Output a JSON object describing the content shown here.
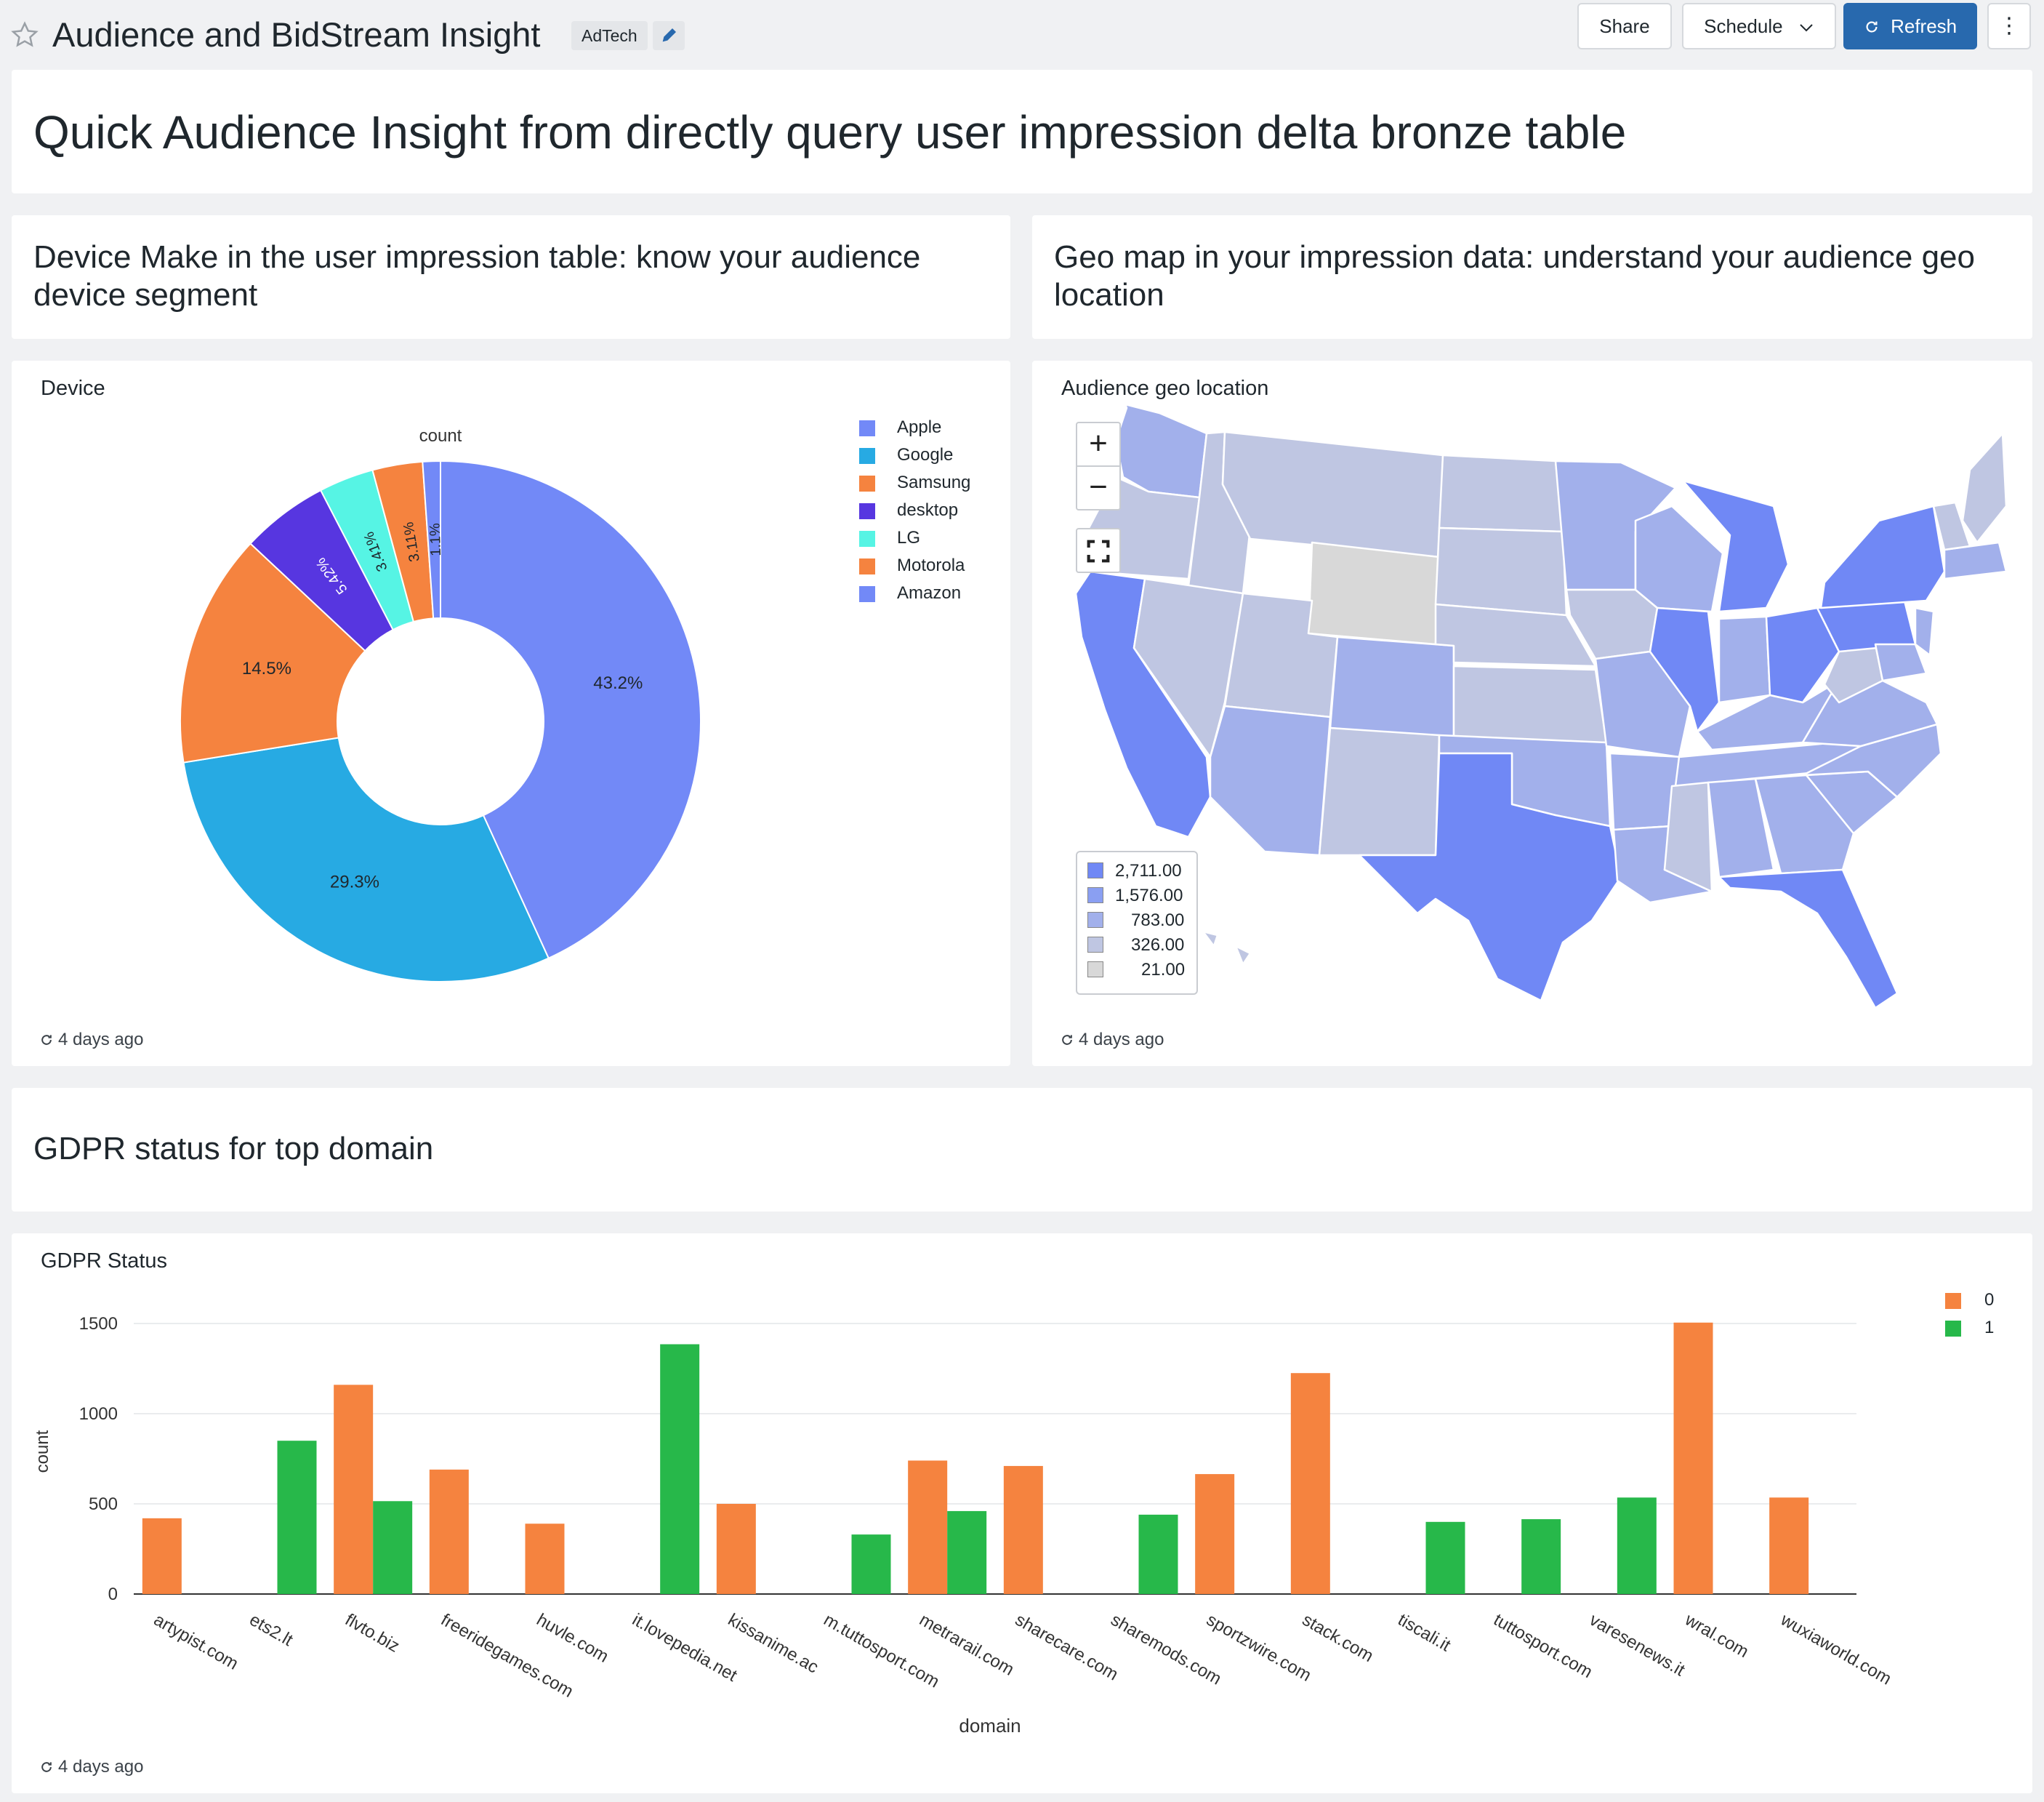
{
  "header": {
    "title": "Audience and BidStream Insight",
    "tag": "AdTech",
    "share_label": "Share",
    "schedule_label": "Schedule",
    "refresh_label": "Refresh",
    "more_label": "⋮"
  },
  "text_widgets": {
    "main_heading": "Quick Audience Insight from directly query user impression delta bronze table",
    "device_heading": "Device Make in the user impression table: know your audience device segment",
    "geo_heading": "Geo map in your impression data: understand your audience geo location",
    "gdpr_heading": "GDPR status for top domain"
  },
  "device_viz": {
    "title": "Device",
    "updated": "4 days ago"
  },
  "geo_viz": {
    "title": "Audience geo location",
    "updated": "4 days ago",
    "zoom_in": "+",
    "zoom_out": "−",
    "legend": [
      {
        "label": "2,711.00",
        "color": "#7088f5"
      },
      {
        "label": "1,576.00",
        "color": "#8a9ff2"
      },
      {
        "label": "783.00",
        "color": "#a2b0eb"
      },
      {
        "label": "326.00",
        "color": "#bfc6e2"
      },
      {
        "label": "21.00",
        "color": "#d8d8d8"
      }
    ]
  },
  "gdpr_viz": {
    "title": "GDPR Status",
    "updated": "4 days ago"
  },
  "chart_data": [
    {
      "type": "pie",
      "title": "count",
      "donut": true,
      "labels": [
        "Apple",
        "Google",
        "Samsung",
        "desktop",
        "LG",
        "Motorola",
        "Amazon"
      ],
      "values": [
        43.2,
        29.3,
        14.5,
        5.42,
        3.41,
        3.11,
        1.1
      ],
      "value_labels": [
        "43.2%",
        "29.3%",
        "14.5%",
        "5.42%",
        "3.41%",
        "3.11%",
        "1.1%"
      ],
      "colors": [
        "#7289f7",
        "#27aae3",
        "#f5833f",
        "#5736e0",
        "#56f4e4",
        "#f5833f",
        "#7289f7"
      ],
      "legend": "top-right"
    },
    {
      "type": "bar",
      "title": "",
      "xlabel": "domain",
      "ylabel": "count",
      "ylim": [
        0,
        1500
      ],
      "yticks": [
        0,
        500,
        1000,
        1500
      ],
      "grid": true,
      "legend": "top-right",
      "categories": [
        "artypist.com",
        "ets2.lt",
        "flvto.biz",
        "freeridegames.com",
        "huvle.com",
        "it.lovepedia.net",
        "kissanime.ac",
        "m.tuttosport.com",
        "metrarail.com",
        "sharecare.com",
        "sharemods.com",
        "sportzwire.com",
        "stack.com",
        "tiscali.it",
        "tuttosport.com",
        "varesenews.it",
        "wral.com",
        "wuxiaworld.com"
      ],
      "series": [
        {
          "name": "0",
          "color": "#f5833f",
          "values": [
            420,
            null,
            1160,
            690,
            390,
            null,
            500,
            null,
            740,
            710,
            null,
            665,
            1225,
            null,
            null,
            null,
            1505,
            535
          ]
        },
        {
          "name": "1",
          "color": "#27b84a",
          "values": [
            null,
            850,
            515,
            null,
            null,
            1385,
            null,
            330,
            460,
            null,
            440,
            null,
            null,
            400,
            415,
            535,
            null,
            null
          ]
        }
      ]
    }
  ]
}
